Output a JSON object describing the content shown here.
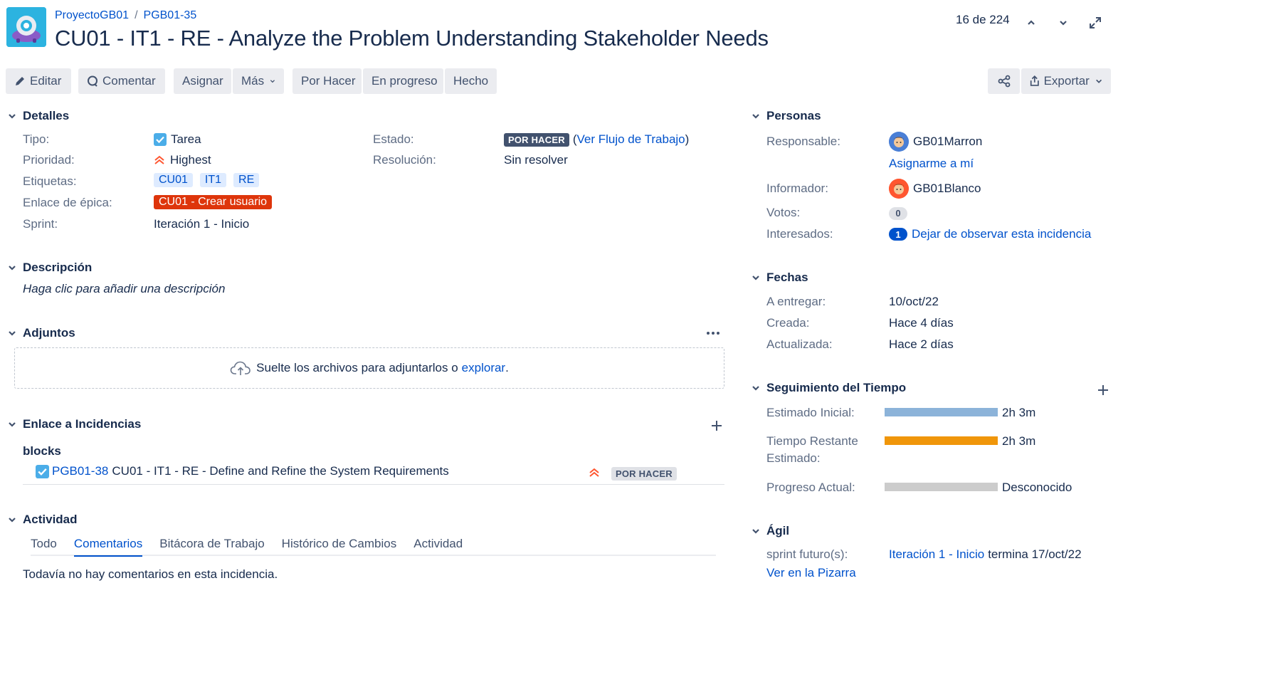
{
  "header": {
    "project": "ProyectoGB01",
    "separator": "/",
    "issue_key": "PGB01-35",
    "title": "CU01 - IT1 - RE - Analyze the Problem Understanding Stakeholder Needs",
    "pager": "16 de 224"
  },
  "toolbar": {
    "edit": "Editar",
    "comment": "Comentar",
    "assign": "Asignar",
    "more": "Más",
    "todo": "Por Hacer",
    "in_progress": "En progreso",
    "done": "Hecho",
    "export": "Exportar"
  },
  "details": {
    "heading": "Detalles",
    "type_label": "Tipo:",
    "type_value": "Tarea",
    "priority_label": "Prioridad:",
    "priority_value": "Highest",
    "labels_label": "Etiquetas:",
    "labels": [
      "CU01",
      "IT1",
      "RE"
    ],
    "epic_label": "Enlace de épica:",
    "epic_value": "CU01 - Crear usuario",
    "sprint_label": "Sprint:",
    "sprint_value": "Iteración 1 - Inicio",
    "status_label": "Estado:",
    "status_value": "POR HACER",
    "workflow_link": "Ver Flujo de Trabajo",
    "resolution_label": "Resolución:",
    "resolution_value": "Sin resolver"
  },
  "description": {
    "heading": "Descripción",
    "placeholder": "Haga clic para añadir una descripción"
  },
  "attachments": {
    "heading": "Adjuntos",
    "drop_text": "Suelte los archivos para adjuntarlos o",
    "browse_link": "explorar",
    "period": "."
  },
  "links": {
    "heading": "Enlace a Incidencias",
    "relation": "blocks",
    "item_key": "PGB01-38",
    "item_title": "CU01 - IT1 - RE - Define and Refine the System Requirements",
    "item_status": "POR HACER"
  },
  "activity": {
    "heading": "Actividad",
    "tabs": [
      "Todo",
      "Comentarios",
      "Bitácora de Trabajo",
      "Histórico de Cambios",
      "Actividad"
    ],
    "empty": "Todavía no hay comentarios en esta incidencia."
  },
  "people": {
    "heading": "Personas",
    "assignee_label": "Responsable:",
    "assignee": "GB01Marron",
    "assign_me": "Asignarme a mí",
    "reporter_label": "Informador:",
    "reporter": "GB01Blanco",
    "votes_label": "Votos:",
    "votes": "0",
    "watchers_label": "Interesados:",
    "watchers": "1",
    "unwatch": "Dejar de observar esta incidencia"
  },
  "dates": {
    "heading": "Fechas",
    "due_label": "A entregar:",
    "due": "10/oct/22",
    "created_label": "Creada:",
    "created": "Hace 4 días",
    "updated_label": "Actualizada:",
    "updated": "Hace 2 días"
  },
  "time": {
    "heading": "Seguimiento del Tiempo",
    "estimated_label": "Estimado Inicial:",
    "estimated": "2h 3m",
    "estimated_fill": 1.0,
    "remaining_label_1": "Tiempo Restante",
    "remaining_label_2": "Estimado:",
    "remaining": "2h 3m",
    "remaining_fill": 1.0,
    "logged_label": "Progreso Actual:",
    "logged": "Desconocido",
    "logged_fill": 0.0
  },
  "agile": {
    "heading": "Ágil",
    "future_label": "sprint futuro(s):",
    "sprint_link": "Iteración 1 - Inicio",
    "sprint_end": "termina 17/oct/22",
    "board_link": "Ver en la Pizarra"
  },
  "colors": {
    "link": "#0052cc",
    "button_bg": "#ebecf0",
    "epic": "#de350b",
    "estimate_bar": "#8cb3d9",
    "remaining_bar": "#f0960a",
    "logged_bar": "#cccccc",
    "priority": "#ff5630"
  }
}
